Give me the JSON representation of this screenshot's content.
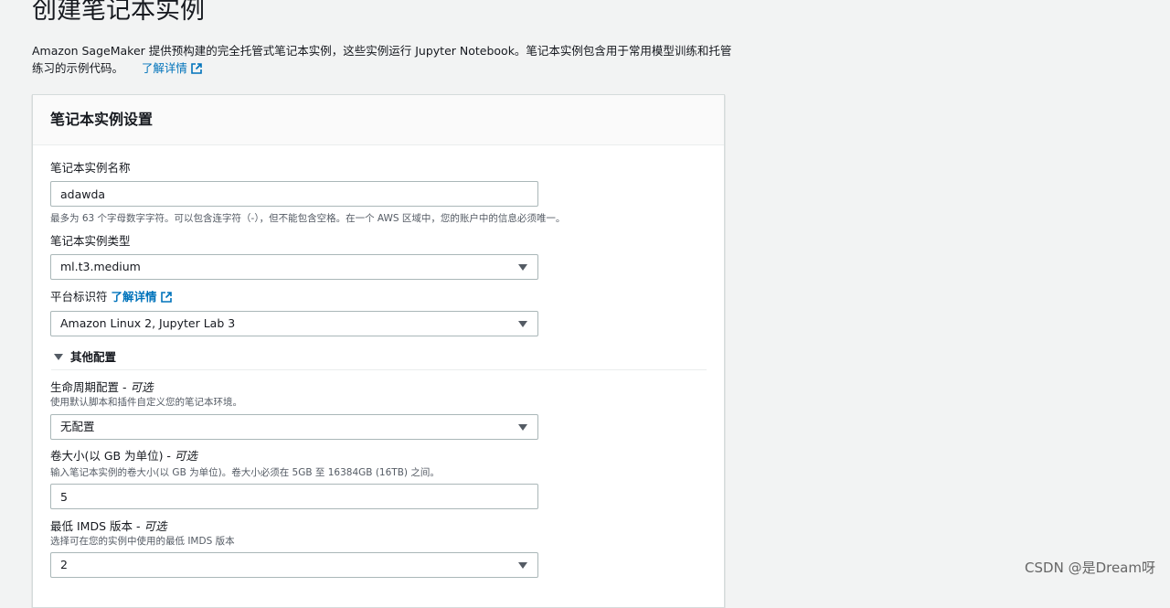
{
  "page": {
    "title": "创建笔记本实例",
    "description": "Amazon SageMaker 提供预构建的完全托管式笔记本实例，这些实例运行 Jupyter Notebook。笔记本实例包含用于常用模型训练和托管练习的示例代码。",
    "learn_more": "了解详情"
  },
  "panel": {
    "title": "笔记本实例设置",
    "name": {
      "label": "笔记本实例名称",
      "value": "adawda",
      "hint": "最多为 63 个字母数字字符。可以包含连字符（-），但不能包含空格。在一个 AWS 区域中，您的账户中的信息必须唯一。"
    },
    "type": {
      "label": "笔记本实例类型",
      "value": "ml.t3.medium"
    },
    "platform": {
      "label": "平台标识符",
      "learn_more": "了解详情",
      "value": "Amazon Linux 2, Jupyter Lab 3"
    },
    "other_config": {
      "label": "其他配置"
    },
    "lifecycle": {
      "label": "生命周期配置 - ",
      "optional": "可选",
      "hint": "使用默认脚本和插件自定义您的笔记本环境。",
      "value": "无配置"
    },
    "volume": {
      "label": "卷大小(以 GB 为单位) - ",
      "optional": "可选",
      "hint": "输入笔记本实例的卷大小(以 GB 为单位)。卷大小必须在 5GB 至 16384GB (16TB) 之间。",
      "value": "5"
    },
    "imds": {
      "label": "最低 IMDS 版本 - ",
      "optional": "可选",
      "hint": "选择可在您的实例中使用的最低 IMDS 版本",
      "value": "2"
    }
  },
  "watermark": "CSDN @是Dream呀",
  "colors": {
    "link": "#0073bb",
    "background": "#f2f3f3",
    "panel": "#ffffff"
  }
}
